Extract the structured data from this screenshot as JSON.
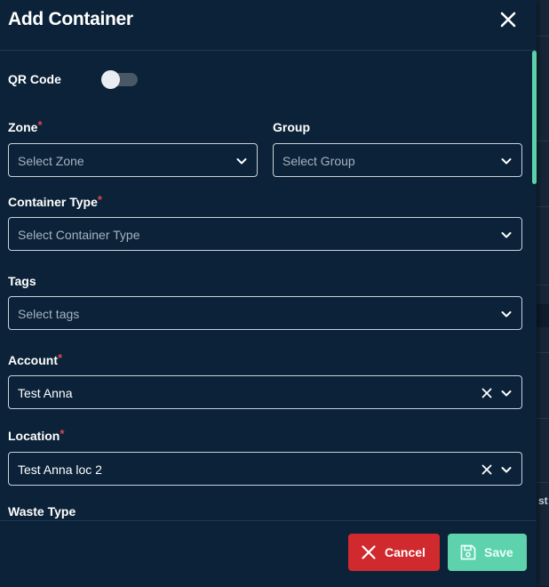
{
  "modal": {
    "title": "Add Container"
  },
  "form": {
    "qr_code": {
      "label": "QR Code",
      "enabled": false
    },
    "zone": {
      "label": "Zone",
      "required": "*",
      "placeholder": "Select Zone"
    },
    "group": {
      "label": "Group",
      "placeholder": "Select Group"
    },
    "container_type": {
      "label": "Container Type",
      "required": "*",
      "placeholder": "Select Container Type"
    },
    "tags": {
      "label": "Tags",
      "placeholder": "Select tags"
    },
    "account": {
      "label": "Account",
      "required": "*",
      "value": "Test Anna"
    },
    "location": {
      "label": "Location",
      "required": "*",
      "value": "Test Anna loc 2"
    },
    "waste_type": {
      "label": "Waste Type"
    }
  },
  "footer": {
    "cancel_label": "Cancel",
    "save_label": "Save"
  },
  "background": {
    "partial_text": "st"
  },
  "colors": {
    "modal_bg": "#0b2238",
    "required": "#e0454f",
    "cancel": "#d02a2f",
    "save": "#5dd2ad",
    "scrollbar": "#5ad1ac"
  }
}
